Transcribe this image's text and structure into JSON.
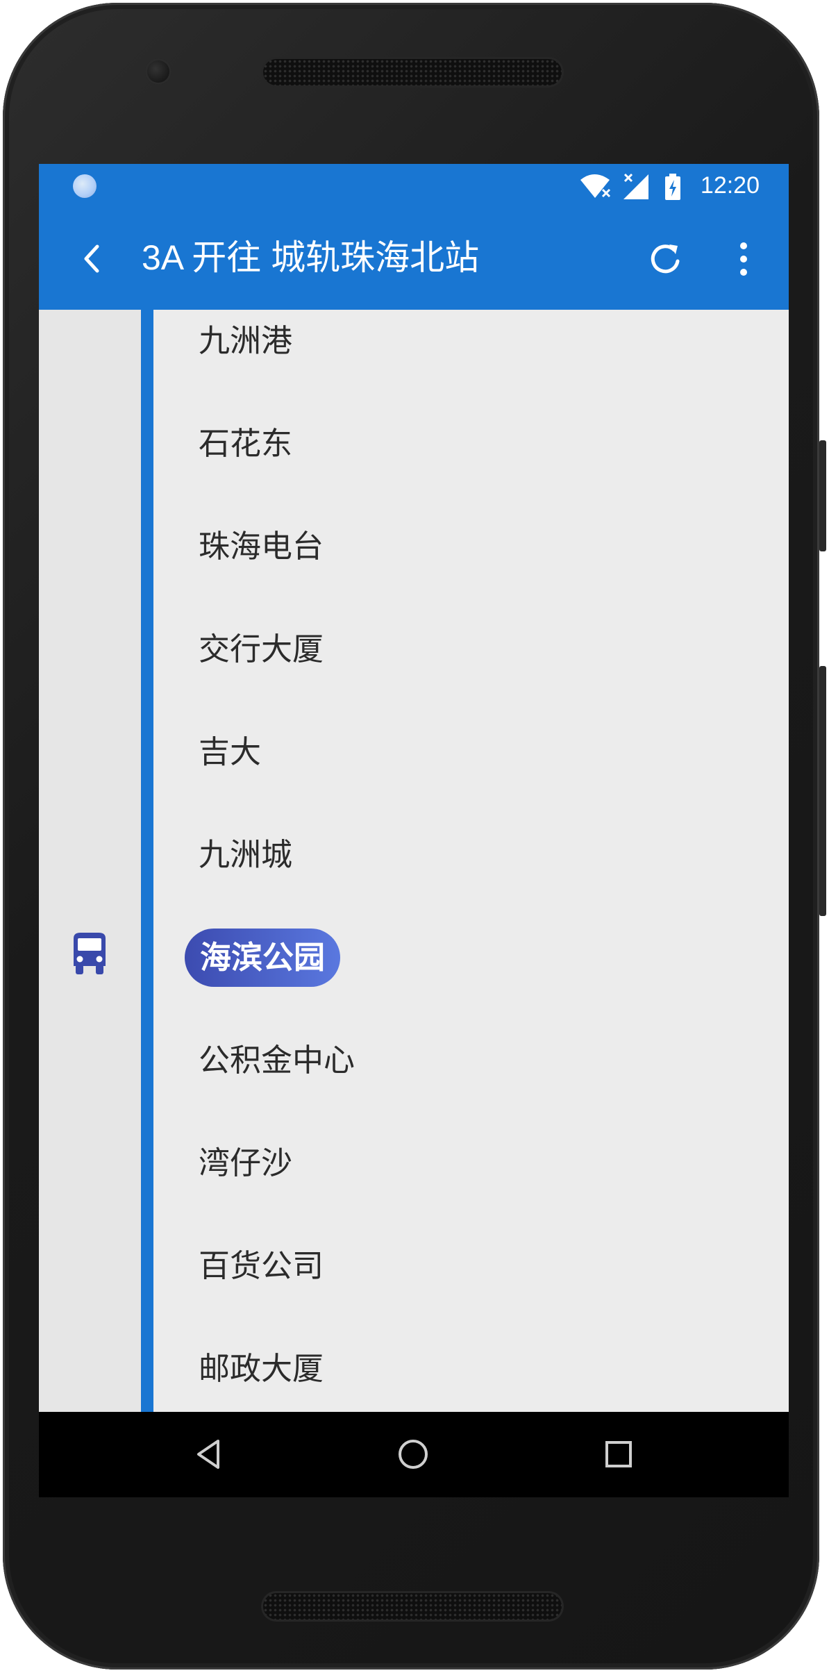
{
  "status_bar": {
    "time": "12:20",
    "icons": [
      "notification-dot-icon",
      "wifi-icon",
      "cell-signal-icon",
      "battery-charging-icon"
    ]
  },
  "app_bar": {
    "title": "3A 开往 城轨珠海北站",
    "actions": [
      "back-icon",
      "refresh-icon",
      "more-vert-icon"
    ]
  },
  "route": {
    "line_color": "#1976d2",
    "current_stop_index": 6,
    "stops": [
      {
        "name": "九洲港"
      },
      {
        "name": "石花东"
      },
      {
        "name": "珠海电台"
      },
      {
        "name": "交行大厦"
      },
      {
        "name": "吉大"
      },
      {
        "name": "九洲城"
      },
      {
        "name": "海滨公园"
      },
      {
        "name": "公积金中心"
      },
      {
        "name": "湾仔沙"
      },
      {
        "name": "百货公司"
      },
      {
        "name": "邮政大厦"
      }
    ]
  },
  "nav_bar": {
    "buttons": [
      "back-triangle-icon",
      "home-circle-icon",
      "recents-square-icon"
    ]
  },
  "colors": {
    "primary": "#1976d2",
    "current_stop_badge": "#4a5fcf",
    "bus_icon": "#3949ab",
    "list_background": "#ececec"
  }
}
